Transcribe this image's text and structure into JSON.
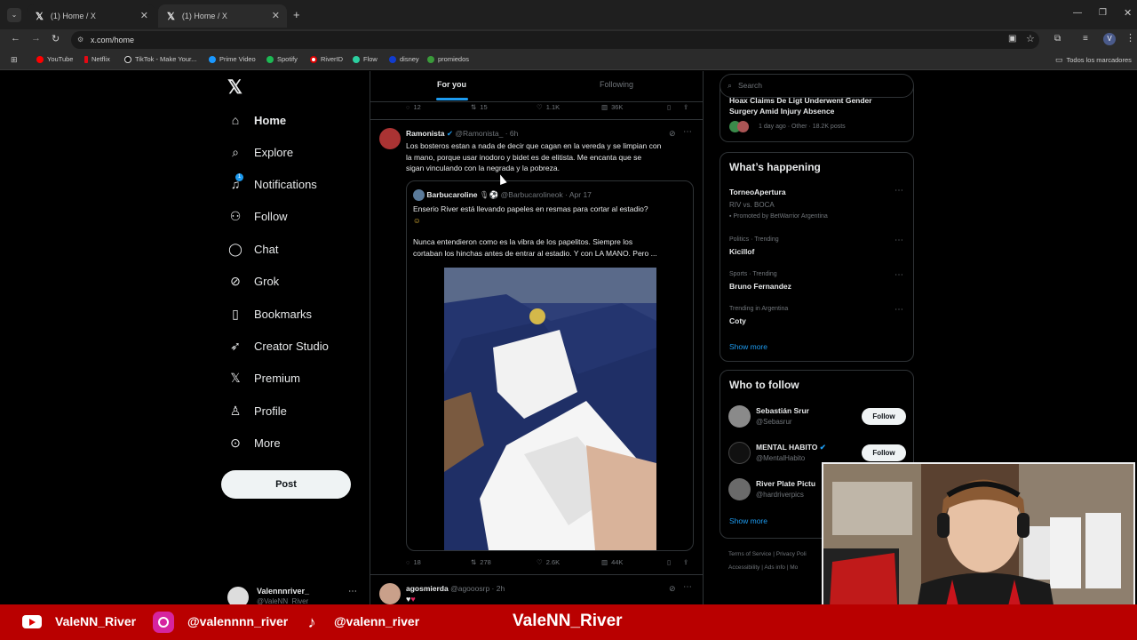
{
  "browser": {
    "tabs": [
      {
        "title": "(1) Home / X"
      },
      {
        "title": "(1) Home / X"
      }
    ],
    "url": "x.com/home",
    "bookmarks": [
      "YouTube",
      "Netflix",
      "TikTok - Make Your...",
      "Prime Video",
      "Spotify",
      "RiverID",
      "Flow",
      "disney",
      "promiedos"
    ],
    "all_bookmarks": "Todos los marcadores",
    "profile_initial": "V"
  },
  "nav": {
    "items": [
      "Home",
      "Explore",
      "Notifications",
      "Follow",
      "Chat",
      "Grok",
      "Bookmarks",
      "Creator Studio",
      "Premium",
      "Profile",
      "More"
    ],
    "notification_badge": "1",
    "post_label": "Post",
    "account_name": "Valennnriver_",
    "account_handle": "@ValeNN_River"
  },
  "timeline": {
    "tabs": [
      "For you",
      "Following"
    ],
    "prev_actions": {
      "replies": "12",
      "reposts": "15",
      "likes": "1.1K",
      "views": "36K"
    },
    "tweet": {
      "name": "Ramonista",
      "handle": "@Ramonista_",
      "time": "6h",
      "text_lines": [
        "Los bosteros estan a nada de decir que cagan en la vereda y se limpian con",
        "la mano, porque usar inodoro y bidet es de elitista. Me encanta que se",
        "sigan vinculando con la negrada y la pobreza."
      ],
      "quote": {
        "name": "Barbucaroline",
        "handle": "@Barbucarolineok",
        "time": "Apr 17",
        "line1": "Enserio River está llevando papeles en resmas para cortar al estadio?",
        "line2": "Nunca entendieron como es la vibra de los papelitos. Siempre los",
        "line3": "cortaban los hinchas antes de entrar al estadio. Y con LA MANO. Pero ..."
      },
      "actions": {
        "replies": "18",
        "reposts": "278",
        "likes": "2.6K",
        "views": "44K"
      }
    },
    "next_tweet": {
      "name": "agosmierda",
      "handle": "@agooosrp",
      "time": "2h"
    }
  },
  "sidebar": {
    "search_placeholder": "Search",
    "top_story": {
      "title_line1": "Hoax Claims De Ligt Underwent Gender",
      "title_line2": "Surgery Amid Injury Absence",
      "meta": "1 day ago · Other · 18.2K posts"
    },
    "happening_title": "What’s happening",
    "trends": [
      {
        "name": "TorneoApertura",
        "sub": "RIV vs. BOCA",
        "promo": "Promoted by BetWarrior Argentina"
      },
      {
        "meta": "Politics · Trending",
        "name": "Kicillof"
      },
      {
        "meta": "Sports · Trending",
        "name": "Bruno Fernandez"
      },
      {
        "meta": "Trending in Argentina",
        "name": "Coty"
      }
    ],
    "show_more": "Show more",
    "who_to_follow_title": "Who to follow",
    "follow_suggestions": [
      {
        "name": "Sebastián Srur",
        "handle": "@Sebasrur",
        "button": "Follow"
      },
      {
        "name": "MENTAL HABITO",
        "handle": "@MentalHabito",
        "button": "Follow"
      },
      {
        "name": "River Plate Pictu",
        "handle": "@hardriverpics",
        "button": "Follow"
      }
    ],
    "footer_links": [
      "Terms of Service",
      "|",
      "Privacy Poli",
      "Accessibility",
      "|",
      "Ads info",
      "|",
      "Mo"
    ]
  },
  "banner": {
    "youtube": "ValeNN_River",
    "instagram": "@valennnn_river",
    "tiktok": "@valenn_river",
    "center": "ValeNN_River"
  },
  "colors": {
    "accent": "#1d9bf0",
    "banner": "#b90000"
  }
}
